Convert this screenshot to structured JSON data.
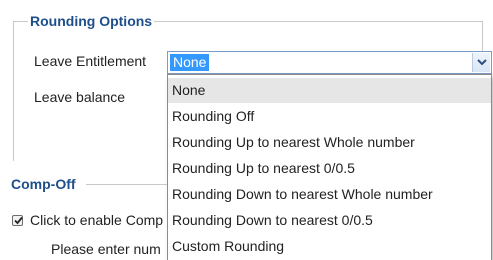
{
  "rounding_options": {
    "legend": "Rounding Options",
    "leave_entitlement_label": "Leave Entitlement",
    "leave_balance_label": "Leave balance",
    "select": {
      "value": "None",
      "options": [
        "None",
        "Rounding Off",
        "Rounding Up to nearest Whole number",
        "Rounding Up to nearest 0/0.5",
        "Rounding Down to nearest Whole number",
        "Rounding Down to nearest 0/0.5",
        "Custom Rounding"
      ]
    }
  },
  "comp_off": {
    "legend": "Comp-Off",
    "enable_label": "Click to enable Comp",
    "enable_checked": true,
    "enter_label": "Please enter num"
  },
  "colors": {
    "legend": "#1f4f8b",
    "selection": "#3399ff",
    "hover_item": "#e6e6e6"
  },
  "icons": {
    "dropdown_arrow": "chevron-down-icon",
    "checkbox": "checkmark-icon"
  }
}
